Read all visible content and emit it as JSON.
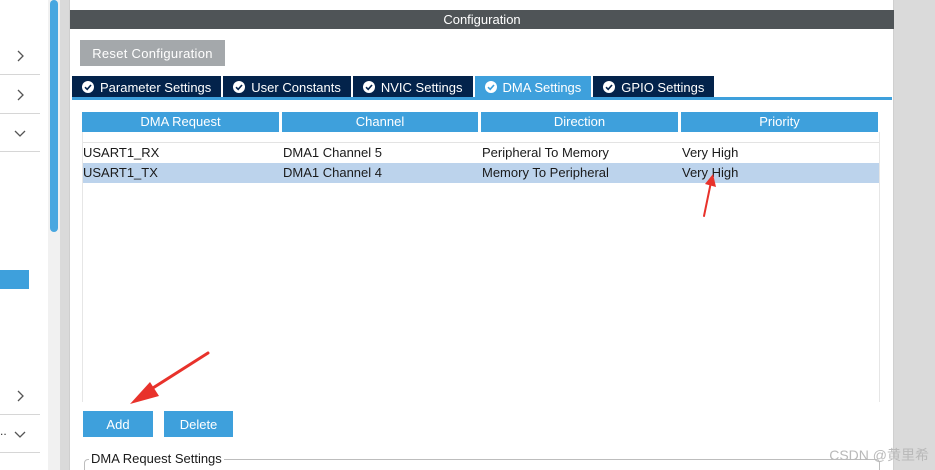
{
  "config_panel": {
    "title": "Configuration",
    "reset_label": "Reset Configuration",
    "tabs": [
      {
        "label": "Parameter Settings",
        "active": false
      },
      {
        "label": "User Constants",
        "active": false
      },
      {
        "label": "NVIC Settings",
        "active": false
      },
      {
        "label": "DMA Settings",
        "active": true
      },
      {
        "label": "GPIO Settings",
        "active": false
      }
    ]
  },
  "dma_table": {
    "columns": [
      "DMA Request",
      "Channel",
      "Direction",
      "Priority"
    ],
    "rows": [
      {
        "request": "USART1_RX",
        "channel": "DMA1 Channel 5",
        "direction": "Peripheral To Memory",
        "priority": "Very High",
        "selected": false
      },
      {
        "request": "USART1_TX",
        "channel": "DMA1 Channel 4",
        "direction": "Memory To Peripheral",
        "priority": "Very High",
        "selected": true
      }
    ]
  },
  "actions": {
    "add_label": "Add",
    "delete_label": "Delete"
  },
  "group": {
    "label": "DMA Request Settings"
  },
  "left_sidebar": {
    "ellipsis": ".."
  },
  "watermark": "CSDN @黄里希",
  "icons": {
    "tab_status": "check-circle-icon",
    "sidebar_expand": "chevron-right-icon",
    "sidebar_collapse": "chevron-down-icon"
  },
  "colors": {
    "accent": "#3ea0dc",
    "tab_dark": "#03234b",
    "header_dark": "#4f5457",
    "reset_gray": "#a4a8ab",
    "selection": "#bcd3ec",
    "annotation_red": "#e8322b"
  }
}
